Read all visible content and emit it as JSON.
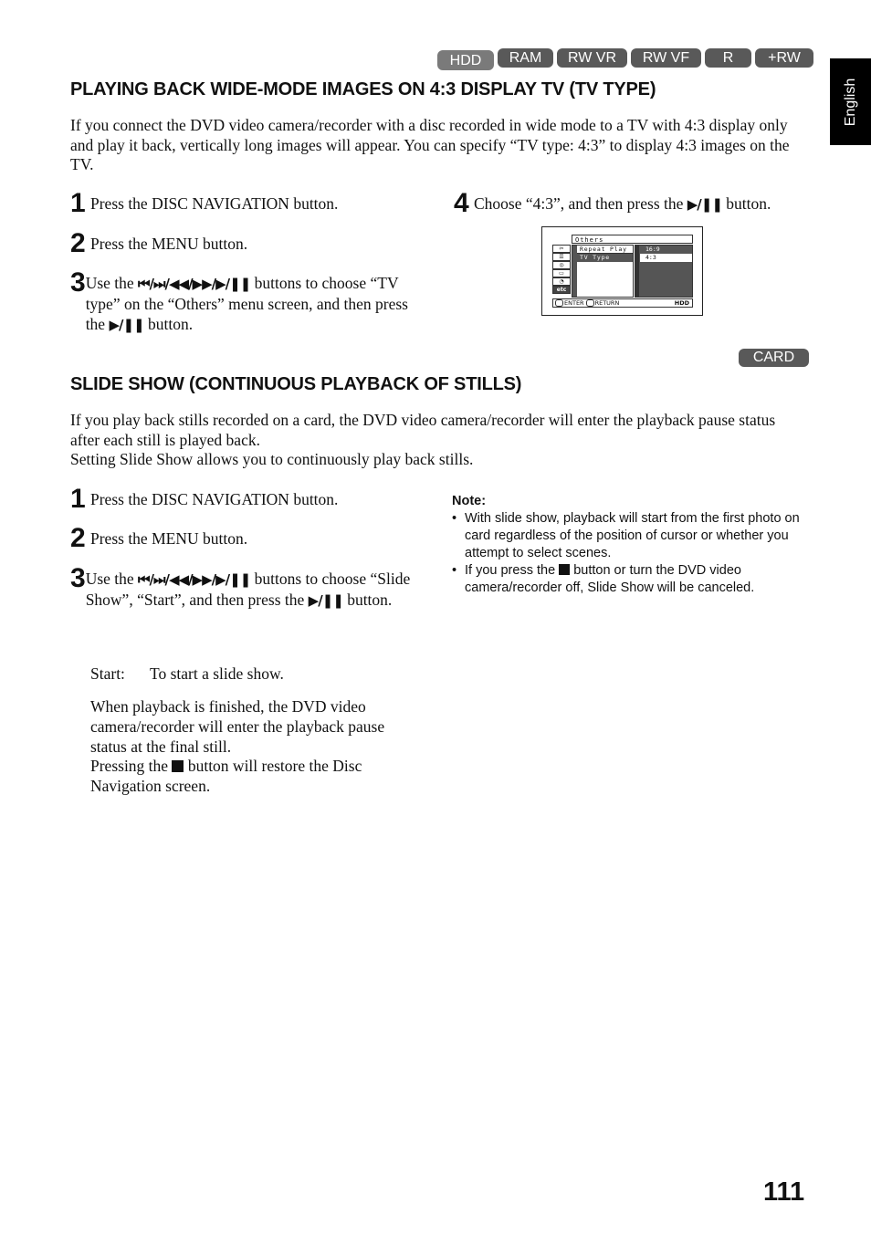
{
  "media_tags": [
    "HDD",
    "RAM",
    "RW VR",
    "RW VF",
    "R",
    "+RW"
  ],
  "language_tab": "English",
  "section1": {
    "title": "PLAYING BACK WIDE-MODE IMAGES ON 4:3 DISPLAY TV (TV TYPE)",
    "intro": "If you connect the DVD video camera/recorder with a disc recorded in wide mode to a TV with 4:3 display only and play it back, vertically long images will appear. You can specify “TV type: 4:3” to display 4:3 images on the TV.",
    "steps": [
      {
        "num": "1",
        "text": "Press the DISC NAVIGATION button."
      },
      {
        "num": "2",
        "text": "Press the MENU button."
      },
      {
        "num": "3",
        "pre": "Use the",
        "symbols": "⏮/⏭/◀◀/▶▶/▶/❚❚",
        "post": "buttons to choose “TV type” on the “Others” menu screen, and then press the",
        "symbol2": "▶/❚❚",
        "end": "button."
      },
      {
        "num": "4",
        "pre": "Choose “4:3”, and then press the",
        "symbol": "▶/❚❚",
        "post": "button."
      }
    ],
    "menu_screen": {
      "title": "Others",
      "items": [
        "Repeat Play",
        "TV Type"
      ],
      "options": [
        "16:9",
        "4:3"
      ],
      "selected_option": "4:3",
      "icons": [
        "camera-icon",
        "list-icon",
        "disc-icon",
        "card-icon",
        "gauge-icon",
        "etc"
      ],
      "footer_enter": "ENTER",
      "footer_return": "RETURN",
      "footer_media": "HDD"
    }
  },
  "section2": {
    "tag": "CARD",
    "title": "SLIDE SHOW (CONTINUOUS PLAYBACK OF STILLS)",
    "intro_1": "If you play back stills recorded on a card, the DVD video camera/recorder will enter the playback pause status after each still is played back.",
    "intro_2": "Setting Slide Show allows you to continuously play back stills.",
    "steps": [
      {
        "num": "1",
        "text": "Press the DISC NAVIGATION button."
      },
      {
        "num": "2",
        "text": "Press the MENU button."
      },
      {
        "num": "3",
        "pre": "Use the",
        "symbols": "⏮/⏭/◀◀/▶▶/▶/❚❚",
        "post": "buttons to choose “Slide Show”, “Start”, and then press the",
        "symbol2": "▶/❚❚",
        "end": "button."
      }
    ],
    "start_label": "Start:",
    "start_desc": "To start a slide show.",
    "after_1": "When playback is finished, the DVD video camera/recorder will enter the playback pause status at the final still.",
    "after_2_pre": "Pressing the",
    "after_2_post": "button will restore the Disc Navigation screen.",
    "note": {
      "title": "Note:",
      "items": [
        {
          "text": "With slide show, playback will start from the first photo on card regardless of the position of cursor or whether you attempt to select scenes."
        },
        {
          "pre": "If you press the",
          "post": "button or turn the DVD video camera/recorder off, Slide Show will be canceled."
        }
      ]
    }
  },
  "page_number": "111"
}
